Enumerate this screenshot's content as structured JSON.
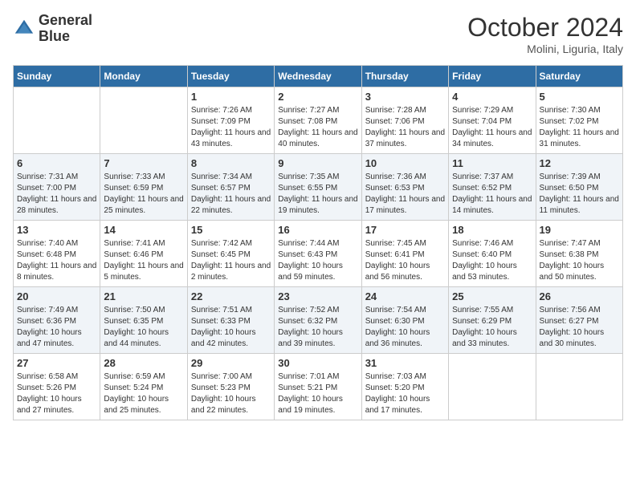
{
  "header": {
    "logo_line1": "General",
    "logo_line2": "Blue",
    "month_title": "October 2024",
    "location": "Molini, Liguria, Italy"
  },
  "days_of_week": [
    "Sunday",
    "Monday",
    "Tuesday",
    "Wednesday",
    "Thursday",
    "Friday",
    "Saturday"
  ],
  "weeks": [
    [
      {
        "num": "",
        "sunrise": "",
        "sunset": "",
        "daylight": ""
      },
      {
        "num": "",
        "sunrise": "",
        "sunset": "",
        "daylight": ""
      },
      {
        "num": "1",
        "sunrise": "Sunrise: 7:26 AM",
        "sunset": "Sunset: 7:09 PM",
        "daylight": "Daylight: 11 hours and 43 minutes."
      },
      {
        "num": "2",
        "sunrise": "Sunrise: 7:27 AM",
        "sunset": "Sunset: 7:08 PM",
        "daylight": "Daylight: 11 hours and 40 minutes."
      },
      {
        "num": "3",
        "sunrise": "Sunrise: 7:28 AM",
        "sunset": "Sunset: 7:06 PM",
        "daylight": "Daylight: 11 hours and 37 minutes."
      },
      {
        "num": "4",
        "sunrise": "Sunrise: 7:29 AM",
        "sunset": "Sunset: 7:04 PM",
        "daylight": "Daylight: 11 hours and 34 minutes."
      },
      {
        "num": "5",
        "sunrise": "Sunrise: 7:30 AM",
        "sunset": "Sunset: 7:02 PM",
        "daylight": "Daylight: 11 hours and 31 minutes."
      }
    ],
    [
      {
        "num": "6",
        "sunrise": "Sunrise: 7:31 AM",
        "sunset": "Sunset: 7:00 PM",
        "daylight": "Daylight: 11 hours and 28 minutes."
      },
      {
        "num": "7",
        "sunrise": "Sunrise: 7:33 AM",
        "sunset": "Sunset: 6:59 PM",
        "daylight": "Daylight: 11 hours and 25 minutes."
      },
      {
        "num": "8",
        "sunrise": "Sunrise: 7:34 AM",
        "sunset": "Sunset: 6:57 PM",
        "daylight": "Daylight: 11 hours and 22 minutes."
      },
      {
        "num": "9",
        "sunrise": "Sunrise: 7:35 AM",
        "sunset": "Sunset: 6:55 PM",
        "daylight": "Daylight: 11 hours and 19 minutes."
      },
      {
        "num": "10",
        "sunrise": "Sunrise: 7:36 AM",
        "sunset": "Sunset: 6:53 PM",
        "daylight": "Daylight: 11 hours and 17 minutes."
      },
      {
        "num": "11",
        "sunrise": "Sunrise: 7:37 AM",
        "sunset": "Sunset: 6:52 PM",
        "daylight": "Daylight: 11 hours and 14 minutes."
      },
      {
        "num": "12",
        "sunrise": "Sunrise: 7:39 AM",
        "sunset": "Sunset: 6:50 PM",
        "daylight": "Daylight: 11 hours and 11 minutes."
      }
    ],
    [
      {
        "num": "13",
        "sunrise": "Sunrise: 7:40 AM",
        "sunset": "Sunset: 6:48 PM",
        "daylight": "Daylight: 11 hours and 8 minutes."
      },
      {
        "num": "14",
        "sunrise": "Sunrise: 7:41 AM",
        "sunset": "Sunset: 6:46 PM",
        "daylight": "Daylight: 11 hours and 5 minutes."
      },
      {
        "num": "15",
        "sunrise": "Sunrise: 7:42 AM",
        "sunset": "Sunset: 6:45 PM",
        "daylight": "Daylight: 11 hours and 2 minutes."
      },
      {
        "num": "16",
        "sunrise": "Sunrise: 7:44 AM",
        "sunset": "Sunset: 6:43 PM",
        "daylight": "Daylight: 10 hours and 59 minutes."
      },
      {
        "num": "17",
        "sunrise": "Sunrise: 7:45 AM",
        "sunset": "Sunset: 6:41 PM",
        "daylight": "Daylight: 10 hours and 56 minutes."
      },
      {
        "num": "18",
        "sunrise": "Sunrise: 7:46 AM",
        "sunset": "Sunset: 6:40 PM",
        "daylight": "Daylight: 10 hours and 53 minutes."
      },
      {
        "num": "19",
        "sunrise": "Sunrise: 7:47 AM",
        "sunset": "Sunset: 6:38 PM",
        "daylight": "Daylight: 10 hours and 50 minutes."
      }
    ],
    [
      {
        "num": "20",
        "sunrise": "Sunrise: 7:49 AM",
        "sunset": "Sunset: 6:36 PM",
        "daylight": "Daylight: 10 hours and 47 minutes."
      },
      {
        "num": "21",
        "sunrise": "Sunrise: 7:50 AM",
        "sunset": "Sunset: 6:35 PM",
        "daylight": "Daylight: 10 hours and 44 minutes."
      },
      {
        "num": "22",
        "sunrise": "Sunrise: 7:51 AM",
        "sunset": "Sunset: 6:33 PM",
        "daylight": "Daylight: 10 hours and 42 minutes."
      },
      {
        "num": "23",
        "sunrise": "Sunrise: 7:52 AM",
        "sunset": "Sunset: 6:32 PM",
        "daylight": "Daylight: 10 hours and 39 minutes."
      },
      {
        "num": "24",
        "sunrise": "Sunrise: 7:54 AM",
        "sunset": "Sunset: 6:30 PM",
        "daylight": "Daylight: 10 hours and 36 minutes."
      },
      {
        "num": "25",
        "sunrise": "Sunrise: 7:55 AM",
        "sunset": "Sunset: 6:29 PM",
        "daylight": "Daylight: 10 hours and 33 minutes."
      },
      {
        "num": "26",
        "sunrise": "Sunrise: 7:56 AM",
        "sunset": "Sunset: 6:27 PM",
        "daylight": "Daylight: 10 hours and 30 minutes."
      }
    ],
    [
      {
        "num": "27",
        "sunrise": "Sunrise: 6:58 AM",
        "sunset": "Sunset: 5:26 PM",
        "daylight": "Daylight: 10 hours and 27 minutes."
      },
      {
        "num": "28",
        "sunrise": "Sunrise: 6:59 AM",
        "sunset": "Sunset: 5:24 PM",
        "daylight": "Daylight: 10 hours and 25 minutes."
      },
      {
        "num": "29",
        "sunrise": "Sunrise: 7:00 AM",
        "sunset": "Sunset: 5:23 PM",
        "daylight": "Daylight: 10 hours and 22 minutes."
      },
      {
        "num": "30",
        "sunrise": "Sunrise: 7:01 AM",
        "sunset": "Sunset: 5:21 PM",
        "daylight": "Daylight: 10 hours and 19 minutes."
      },
      {
        "num": "31",
        "sunrise": "Sunrise: 7:03 AM",
        "sunset": "Sunset: 5:20 PM",
        "daylight": "Daylight: 10 hours and 17 minutes."
      },
      {
        "num": "",
        "sunrise": "",
        "sunset": "",
        "daylight": ""
      },
      {
        "num": "",
        "sunrise": "",
        "sunset": "",
        "daylight": ""
      }
    ]
  ]
}
